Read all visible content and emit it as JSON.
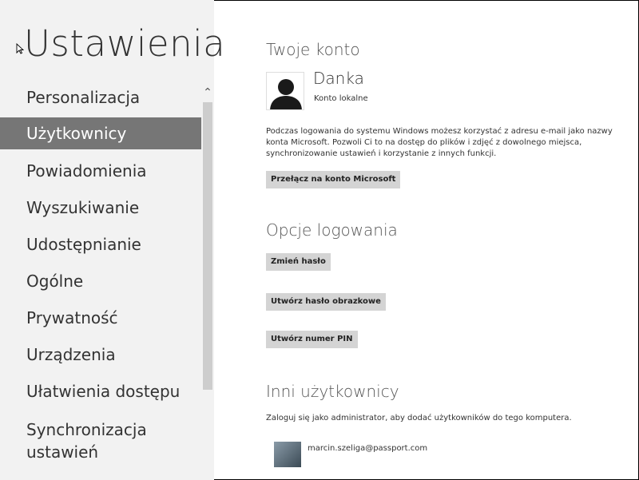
{
  "app": {
    "title": "Ustawienia"
  },
  "sidebar": {
    "items": [
      {
        "label": "Personalizacja"
      },
      {
        "label": "Użytkownicy"
      },
      {
        "label": "Powiadomienia"
      },
      {
        "label": "Wyszukiwanie"
      },
      {
        "label": "Udostępnianie"
      },
      {
        "label": "Ogólne"
      },
      {
        "label": "Prywatność"
      },
      {
        "label": "Urządzenia"
      },
      {
        "label": "Ułatwienia dostępu"
      },
      {
        "label_line1": "Synchronizacja",
        "label_line2": "ustawień"
      }
    ],
    "selected_index": 1
  },
  "account": {
    "section_title": "Twoje konto",
    "name": "Danka",
    "type": "Konto lokalne",
    "description_lines": [
      "Podczas logowania do systemu Windows możesz korzystać z adresu e-mail jako nazwy",
      "konta Microsoft. Pozwoli Ci to na dostęp do plików i zdjęć z dowolnego miejsca,",
      "synchronizowanie ustawień i korzystanie z innych funkcji."
    ],
    "switch_button": "Przełącz na konto Microsoft"
  },
  "signin": {
    "section_title": "Opcje logowania",
    "change_password": "Zmień hasło",
    "picture_password": "Utwórz hasło obrazkowe",
    "pin": "Utwórz numer PIN"
  },
  "other_users": {
    "section_title": "Inni użytkownicy",
    "description": "Zaloguj się jako administrator, aby dodać użytkowników do tego komputera.",
    "users": [
      {
        "email": "marcin.szeliga@passport.com"
      }
    ]
  },
  "colors": {
    "sidebar_bg": "#f2f2f2",
    "selected_bg": "#767676",
    "button_bg": "#d4d4d4"
  }
}
